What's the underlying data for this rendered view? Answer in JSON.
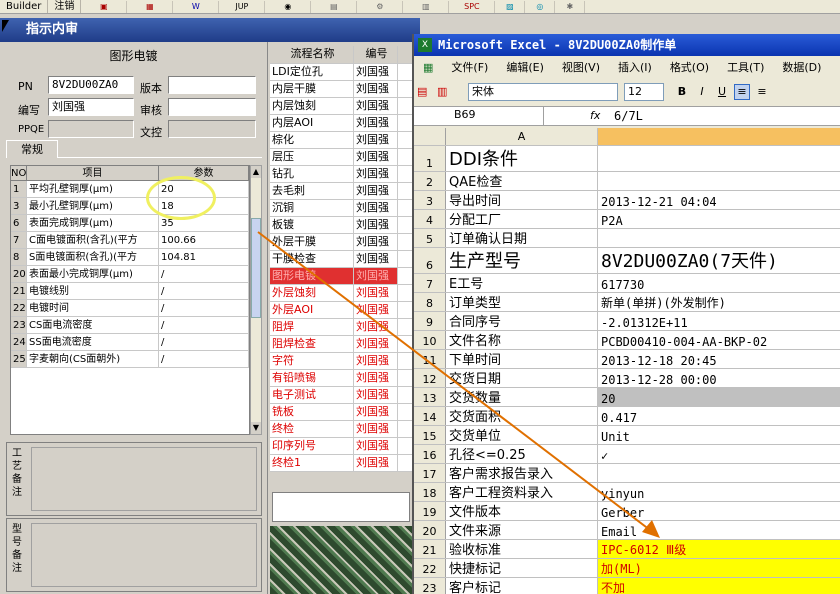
{
  "topbar": {
    "items": [
      "Builder",
      "注销"
    ],
    "icon_labels": [
      "JUP",
      "SPC"
    ]
  },
  "window": {
    "title": "指示内审"
  },
  "plating": {
    "section_title": "图形电镀",
    "pn_label": "PN",
    "pn_value": "8V2DU00ZA0",
    "version_label": "版本",
    "author_label": "编写",
    "author_value": "刘国强",
    "review_label": "审核",
    "ppqe_label": "PPQE",
    "control_label": "文控",
    "tab": "常规",
    "headers": [
      "NO",
      "项目",
      "参数"
    ],
    "rows": [
      {
        "no": "1",
        "item": "平均孔壁铜厚(μm)",
        "param": "20"
      },
      {
        "no": "3",
        "item": "最小孔壁铜厚(μm)",
        "param": "18"
      },
      {
        "no": "6",
        "item": "表面完成铜厚(μm)",
        "param": "35"
      },
      {
        "no": "7",
        "item": "C面电镀面积(含孔)(平方",
        "param": "100.66"
      },
      {
        "no": "8",
        "item": "S面电镀面积(含孔)(平方",
        "param": "104.81"
      },
      {
        "no": "20",
        "item": "表面最小完成铜厚(μm)",
        "param": "/"
      },
      {
        "no": "21",
        "item": "电镀线别",
        "param": "/"
      },
      {
        "no": "22",
        "item": "电镀时间",
        "param": "/"
      },
      {
        "no": "23",
        "item": "CS面电流密度",
        "param": "/"
      },
      {
        "no": "24",
        "item": "SS面电流密度",
        "param": "/"
      },
      {
        "no": "25",
        "item": "字麦朝向(CS面朝外)",
        "param": "/"
      }
    ],
    "note1_label": "工艺备注",
    "note2_label": "型号备注"
  },
  "process": {
    "headers": [
      "流程名称",
      "编号"
    ],
    "rows": [
      {
        "name": "LDI定位孔",
        "id": "刘国强",
        "state": "normal"
      },
      {
        "name": "内层干膜",
        "id": "刘国强",
        "state": "normal"
      },
      {
        "name": "内层蚀刻",
        "id": "刘国强",
        "state": "normal"
      },
      {
        "name": "内层AOI",
        "id": "刘国强",
        "state": "normal"
      },
      {
        "name": "棕化",
        "id": "刘国强",
        "state": "normal"
      },
      {
        "name": "层压",
        "id": "刘国强",
        "state": "normal"
      },
      {
        "name": "钻孔",
        "id": "刘国强",
        "state": "normal"
      },
      {
        "name": "去毛刺",
        "id": "刘国强",
        "state": "normal"
      },
      {
        "name": "沉铜",
        "id": "刘国强",
        "state": "normal"
      },
      {
        "name": "板镀",
        "id": "刘国强",
        "state": "normal"
      },
      {
        "name": "外层干膜",
        "id": "刘国强",
        "state": "normal"
      },
      {
        "name": "干膜检查",
        "id": "刘国强",
        "state": "normal"
      },
      {
        "name": "图形电镀",
        "id": "刘国强",
        "state": "selected"
      },
      {
        "name": "外层蚀刻",
        "id": "刘国强",
        "state": "red"
      },
      {
        "name": "外层AOI",
        "id": "刘国强",
        "state": "red"
      },
      {
        "name": "阻焊",
        "id": "刘国强",
        "state": "red"
      },
      {
        "name": "阻焊检查",
        "id": "刘国强",
        "state": "red"
      },
      {
        "name": "字符",
        "id": "刘国强",
        "state": "red"
      },
      {
        "name": "有铅喷锡",
        "id": "刘国强",
        "state": "red"
      },
      {
        "name": "电子测试",
        "id": "刘国强",
        "state": "red"
      },
      {
        "name": "铣板",
        "id": "刘国强",
        "state": "red"
      },
      {
        "name": "终检",
        "id": "刘国强",
        "state": "red"
      },
      {
        "name": "印序列号",
        "id": "刘国强",
        "state": "red"
      },
      {
        "name": "终检1",
        "id": "刘国强",
        "state": "red"
      }
    ]
  },
  "excel": {
    "title": "Microsoft Excel - 8V2DU00ZA0制作单",
    "menu": [
      "文件(F)",
      "编辑(E)",
      "视图(V)",
      "插入(I)",
      "格式(O)",
      "工具(T)",
      "数据(D)"
    ],
    "font_name": "宋体",
    "font_size": "12",
    "cell_ref": "B69",
    "fx": "fx",
    "formula": "6/7L",
    "col_a": "A",
    "rows": [
      {
        "n": "1",
        "a": "DDI条件",
        "b": "",
        "style": "big"
      },
      {
        "n": "2",
        "a": "QAE检查",
        "b": "",
        "style": ""
      },
      {
        "n": "3",
        "a": "导出时间",
        "b": "2013-12-21 04:04",
        "style": ""
      },
      {
        "n": "4",
        "a": "分配工厂",
        "b": "P2A",
        "style": ""
      },
      {
        "n": "5",
        "a": "订单确认日期",
        "b": "",
        "style": ""
      },
      {
        "n": "6",
        "a": "生产型号",
        "b": "8V2DU00ZA0(7天件)",
        "style": "big"
      },
      {
        "n": "7",
        "a": "E工号",
        "b": "617730",
        "style": ""
      },
      {
        "n": "8",
        "a": "订单类型",
        "b": "新单(单拼)(外发制作)",
        "style": ""
      },
      {
        "n": "9",
        "a": "合同序号",
        "b": "-2.01312E+11",
        "style": ""
      },
      {
        "n": "10",
        "a": "文件名称",
        "b": "PCBD00410-004-AA-BKP-02",
        "style": ""
      },
      {
        "n": "11",
        "a": "下单时间",
        "b": "2013-12-18 20:45",
        "style": ""
      },
      {
        "n": "12",
        "a": "交货日期",
        "b": "2013-12-28 00:00",
        "style": ""
      },
      {
        "n": "13",
        "a": "交货数量",
        "b": "20",
        "style": "gray"
      },
      {
        "n": "14",
        "a": "交货面积",
        "b": "0.417",
        "style": ""
      },
      {
        "n": "15",
        "a": "交货单位",
        "b": "Unit",
        "style": ""
      },
      {
        "n": "16",
        "a": "孔径<=0.25",
        "b": "✓",
        "style": ""
      },
      {
        "n": "17",
        "a": "客户需求报告录入",
        "b": "",
        "style": ""
      },
      {
        "n": "18",
        "a": "客户工程资料录入",
        "b": "yinyun",
        "style": ""
      },
      {
        "n": "19",
        "a": "文件版本",
        "b": "Gerber",
        "style": ""
      },
      {
        "n": "20",
        "a": "文件来源",
        "b": "Email",
        "style": ""
      },
      {
        "n": "21",
        "a": "验收标准",
        "b": "IPC-6012 Ⅲ级",
        "style": "yellow"
      },
      {
        "n": "22",
        "a": "快捷标记",
        "b": "加(ML)",
        "style": "yellow"
      },
      {
        "n": "23",
        "a": "客户标记",
        "b": "不加",
        "style": "yellow"
      }
    ]
  },
  "colors": {
    "title_blue": "#1f3c88",
    "excel_blue": "#0a34b0",
    "selected_red": "#e03030",
    "highlight_yellow": "#ffff00",
    "annotation_yellow": "#f0f060",
    "arrow_orange": "#e07000"
  }
}
